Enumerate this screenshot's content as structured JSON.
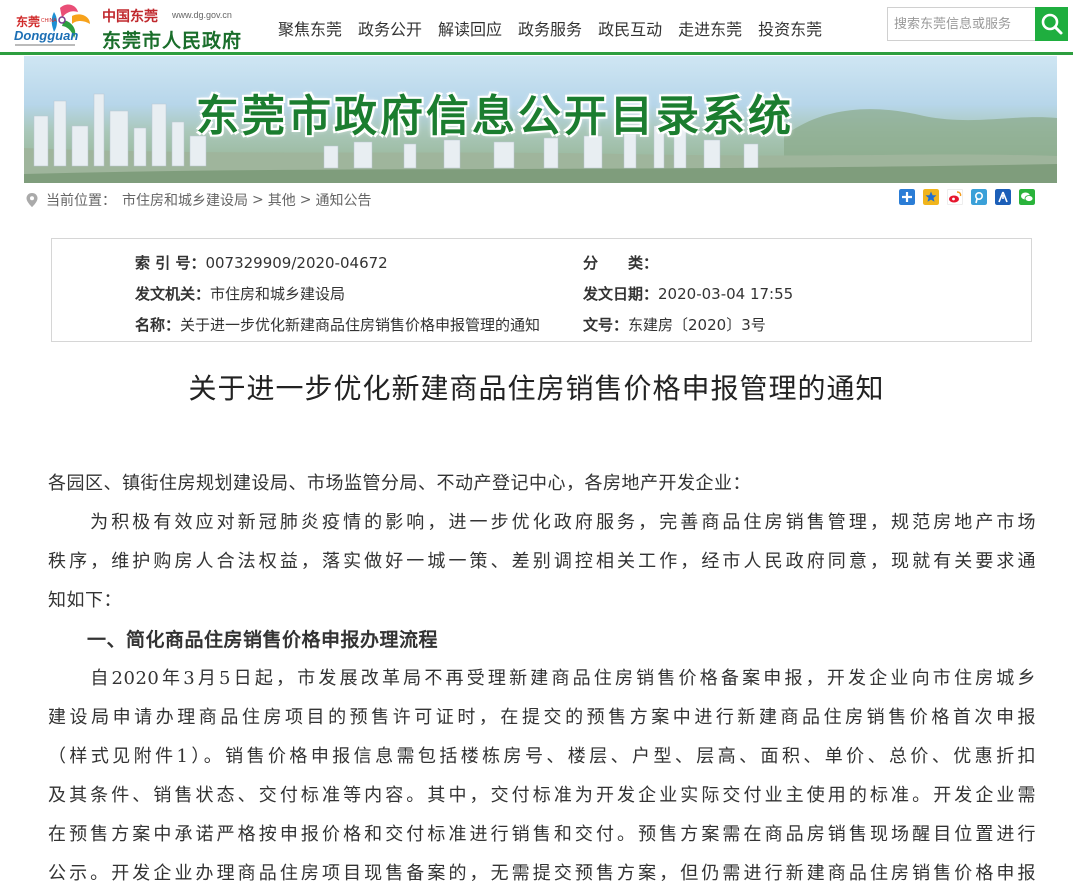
{
  "header": {
    "logo_cn": "中国东莞",
    "logo_url": "www.dg.gov.cn",
    "logo_name": "东莞市人民政府",
    "logo_en": "Dongguan",
    "logo_mark_cn": "东莞",
    "logo_china": "CHINA",
    "nav": [
      "聚焦东莞",
      "政务公开",
      "解读回应",
      "政务服务",
      "政民互动",
      "走进东莞",
      "投资东莞"
    ],
    "search_placeholder": "搜索东莞信息或服务"
  },
  "banner": {
    "title": "东莞市政府信息公开目录系统"
  },
  "breadcrumb": {
    "prefix": "当前位置：",
    "items": [
      "市住房和城乡建设局",
      "其他",
      "通知公告"
    ],
    "sep": ">"
  },
  "share_icons": [
    "qzone-icon",
    "favorite-star-icon",
    "weibo-icon",
    "tencent-weibo-icon",
    "renren-icon",
    "wechat-icon"
  ],
  "meta": {
    "index_label": "索 引 号：",
    "index_value": "007329909/2020-04672",
    "category_label": "分　　类：",
    "category_value": "",
    "issuer_label": "发文机关：",
    "issuer_value": "市住房和城乡建设局",
    "date_label": "发文日期：",
    "date_value": "2020-03-04 17:55",
    "name_label": "名称：",
    "name_value": "关于进一步优化新建商品住房销售价格申报管理的通知",
    "docno_label": "文号：",
    "docno_value": "东建房〔2020〕3号"
  },
  "document": {
    "title": "关于进一步优化新建商品住房销售价格申报管理的通知",
    "lines": [
      "各园区、镇街住房规划建设局、市场监管分局、不动产登记中心，各房地产开发企业：",
      "　　为积极有效应对新冠肺炎疫情的影响，进一步优化政府服务，完善商品住房销售管理，规范房地产市场",
      "秩序，维护购房人合法权益，落实做好一城一策、差别调控相关工作，经市人民政府同意，现就有关要求通",
      "知如下：",
      "　　一、简化商品住房销售价格申报办理流程",
      "　　自2020年3月5日起，市发展改革局不再受理新建商品住房销售价格备案申报，开发企业向市住房城乡",
      "建设局申请办理商品住房项目的预售许可证时，在提交的预售方案中进行新建商品住房销售价格首次申报",
      "（样式见附件1）。销售价格申报信息需包括楼栋房号、楼层、户型、层高、面积、单价、总价、优惠折扣",
      "及其条件、销售状态、交付标准等内容。其中，交付标准为开发企业实际交付业主使用的标准。开发企业需",
      "在预售方案中承诺严格按申报价格和交付标准进行销售和交付。预售方案需在商品房销售现场醒目位置进行",
      "公示。开发企业办理商品住房项目现售备案的，无需提交预售方案，但仍需进行新建商品住房销售价格申报"
    ]
  }
}
